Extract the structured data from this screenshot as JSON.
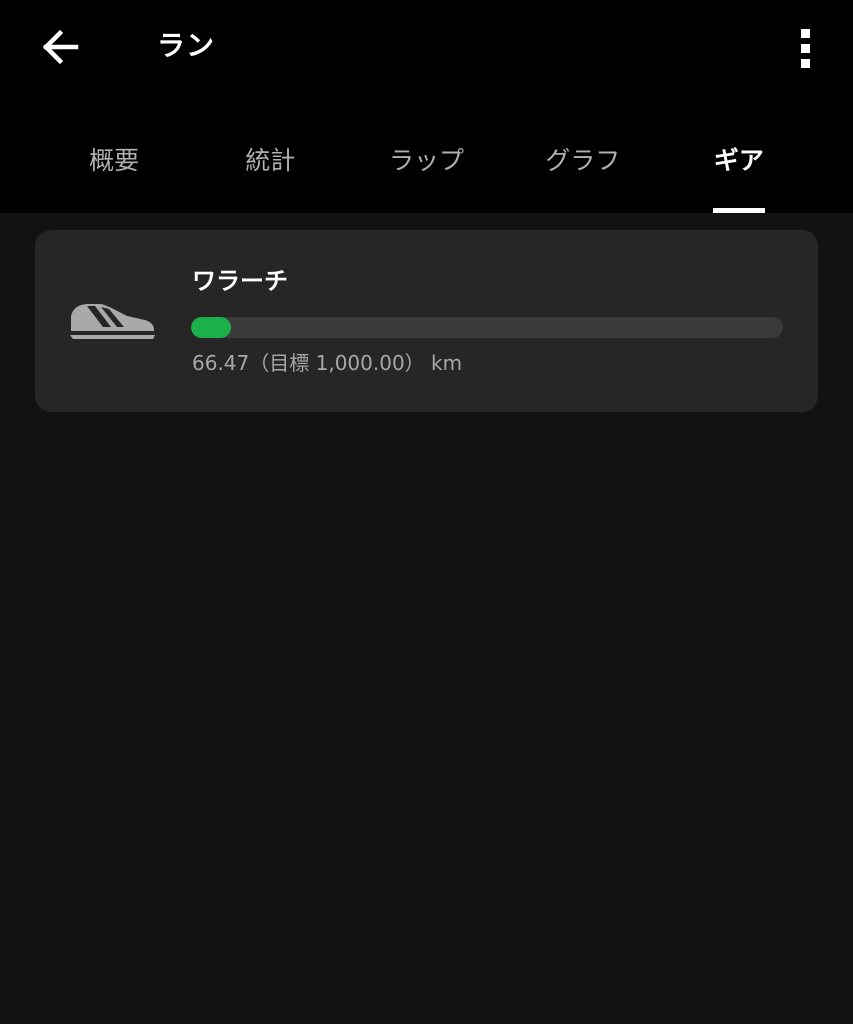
{
  "header": {
    "title": "ラン",
    "back_icon": "arrow-left-icon",
    "menu_icon": "more-vertical-icon"
  },
  "tabs": [
    {
      "label": "概要",
      "active": false
    },
    {
      "label": "統計",
      "active": false
    },
    {
      "label": "ラップ",
      "active": false
    },
    {
      "label": "グラフ",
      "active": false
    },
    {
      "label": "ギア",
      "active": true
    }
  ],
  "gear": {
    "icon": "shoe-icon",
    "name": "ワラーチ",
    "distance_text": "66.47（目標 1,000.00） km",
    "progress_fraction": 0.06647
  },
  "colors": {
    "background": "#121212",
    "header": "#000000",
    "card": "#262626",
    "progress_fill": "#1db04a",
    "progress_track": "#3a3a3a"
  }
}
